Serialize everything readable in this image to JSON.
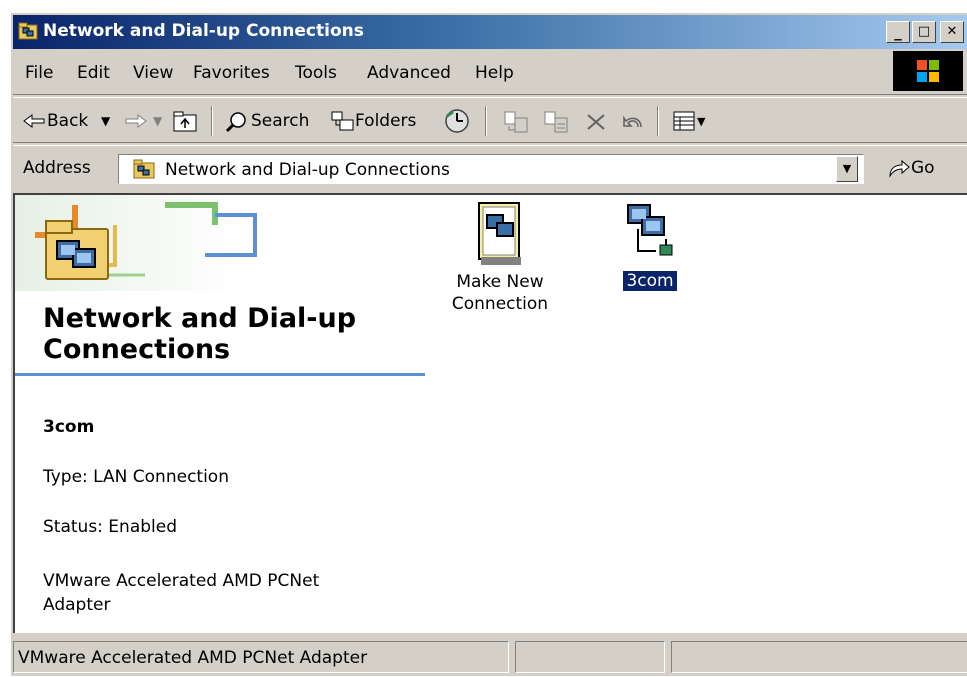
{
  "window": {
    "title": "Network and Dial-up Connections",
    "controls": {
      "minimize": "_",
      "maximize": "□",
      "close": "✕"
    }
  },
  "menu": [
    "File",
    "Edit",
    "View",
    "Favorites",
    "Tools",
    "Advanced",
    "Help"
  ],
  "toolbar": {
    "back_label": "Back",
    "search_label": "Search",
    "folders_label": "Folders"
  },
  "address": {
    "label": "Address",
    "value": "Network and Dial-up Connections",
    "go_label": "Go"
  },
  "left_pane": {
    "title": "Network and Dial-up Connections",
    "selected_name": "3com",
    "type_line": "Type: LAN Connection",
    "status_line": "Status: Enabled",
    "adapter_line": "VMware Accelerated AMD PCNet Adapter"
  },
  "items": [
    {
      "label": "Make New Connection",
      "icon": "make-new-connection-icon",
      "selected": false
    },
    {
      "label": "3com",
      "icon": "lan-connection-icon",
      "selected": true
    }
  ],
  "statusbar": {
    "text": "VMware Accelerated AMD PCNet Adapter"
  },
  "colors": {
    "title_bar_start": "#0a246a",
    "title_bar_end": "#a6caf0",
    "selection": "#0a246a",
    "pane_rule": "#5d8fd3",
    "chrome": "#d4d0c8"
  }
}
